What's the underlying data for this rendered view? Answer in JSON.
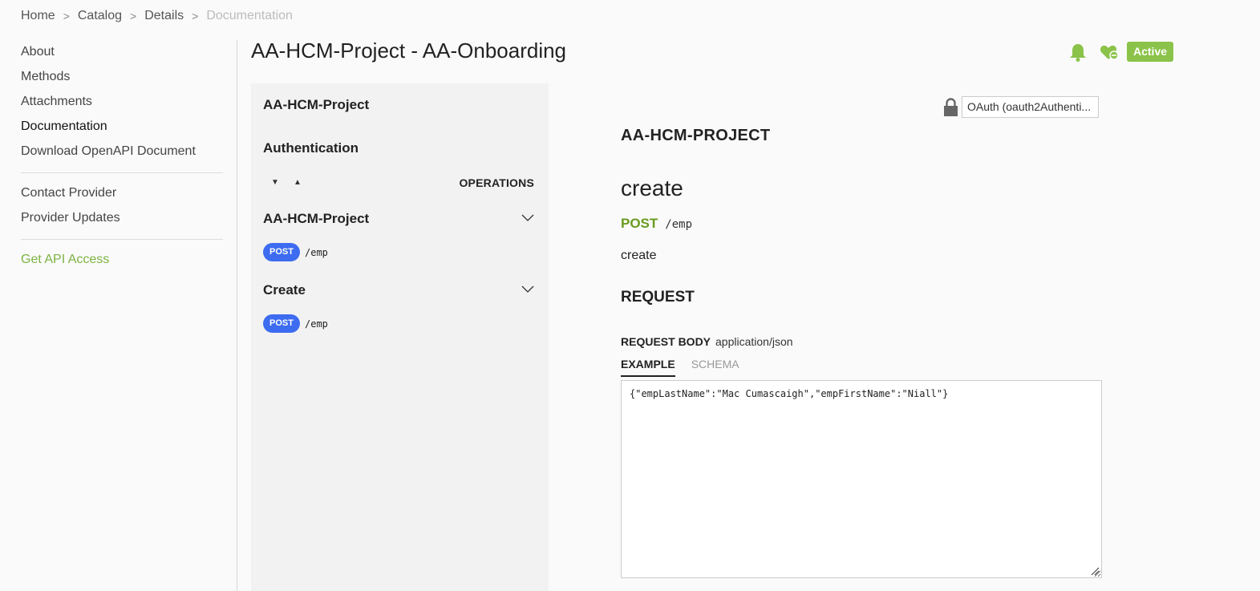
{
  "breadcrumb": [
    {
      "label": "Home"
    },
    {
      "label": "Catalog"
    },
    {
      "label": "Details"
    },
    {
      "label": "Documentation"
    }
  ],
  "sidebar": {
    "items": [
      "About",
      "Methods",
      "Attachments",
      "Documentation",
      "Download OpenAPI Document"
    ],
    "secondary": [
      "Contact Provider",
      "Provider Updates"
    ],
    "cta": "Get API Access"
  },
  "header": {
    "title": "AA-HCM-Project - AA-Onboarding",
    "status": "Active",
    "accent_color": "#8bc34a"
  },
  "ops_panel": {
    "api_name": "AA-HCM-Project",
    "auth_label": "Authentication",
    "operations_label": "OPERATIONS",
    "groups": [
      {
        "title": "AA-HCM-Project",
        "method": "POST",
        "path": "/emp"
      },
      {
        "title": "Create",
        "method": "POST",
        "path": "/emp"
      }
    ]
  },
  "auth_select": {
    "value": "OAuth (oauth2Authenti...",
    "icon": "lock-icon"
  },
  "doc": {
    "api_title": "AA-HCM-PROJECT",
    "operation": "create",
    "method": "POST",
    "path": "/emp",
    "description": "create",
    "request_heading": "REQUEST",
    "request_body_label": "REQUEST BODY",
    "content_type": "application/json",
    "tabs": [
      "EXAMPLE",
      "SCHEMA"
    ],
    "example": "{\"empLastName\":\"Mac Cumascaigh\",\"empFirstName\":\"Niall\"}"
  }
}
